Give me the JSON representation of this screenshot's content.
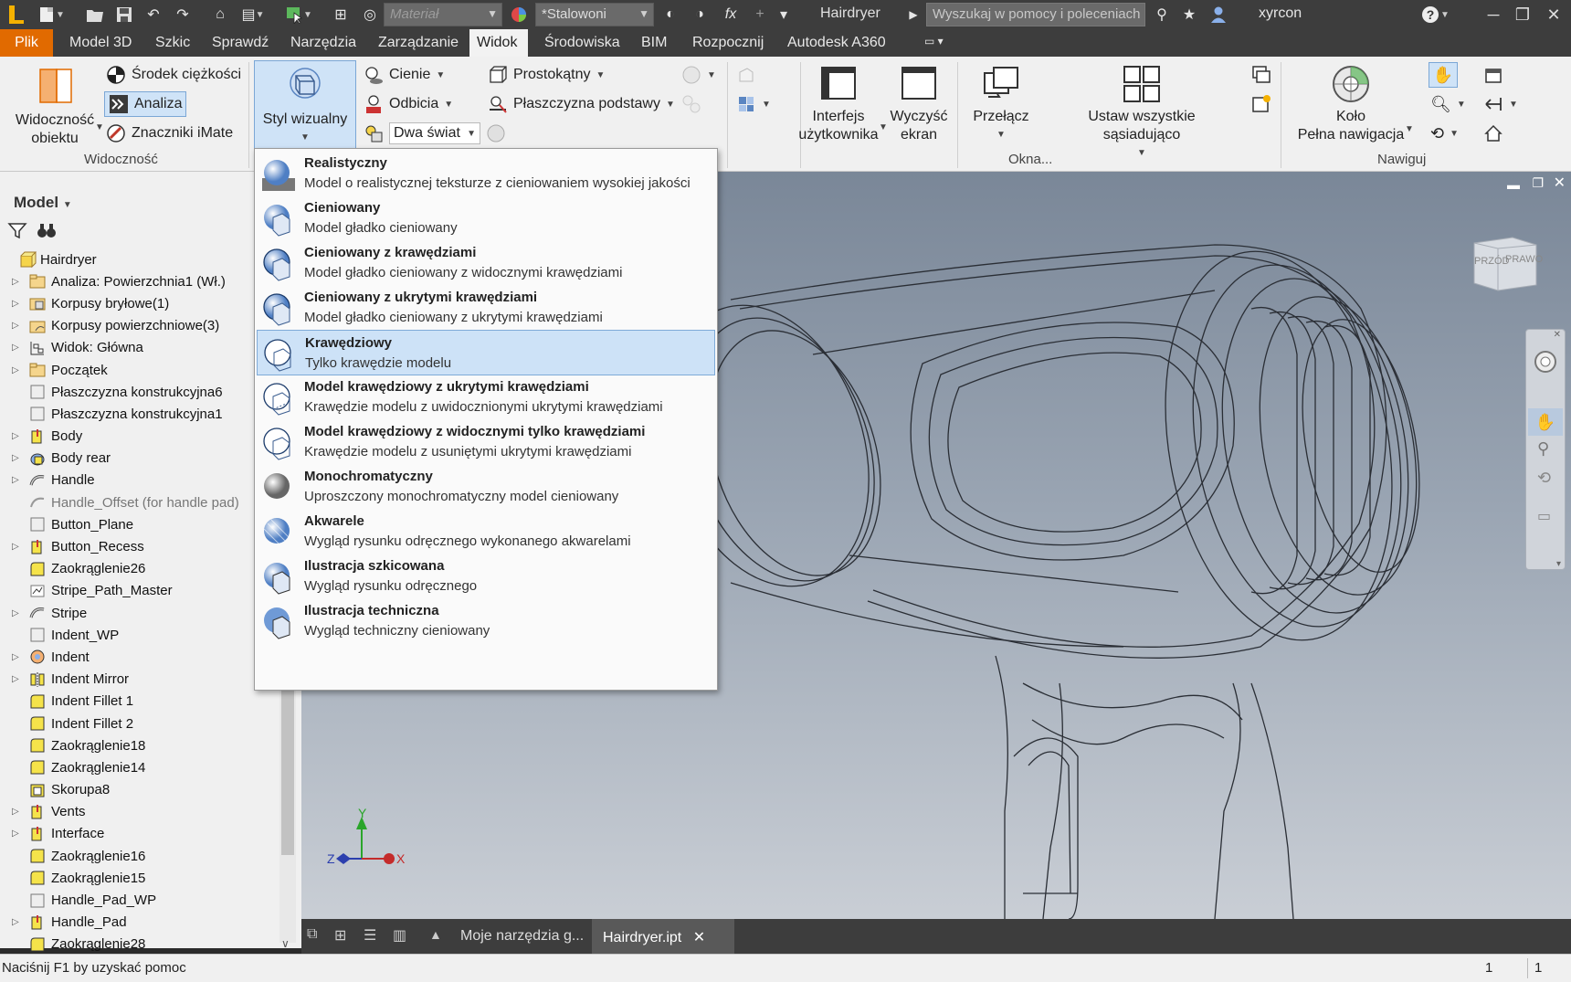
{
  "titlebar": {
    "material_placeholder": "Materiał",
    "appearance_value": "*Stalowoni",
    "title": "Hairdryer",
    "help_search_placeholder": "Wyszukaj w pomocy i poleceniach",
    "username": "xyrcon",
    "fx_label": "fx"
  },
  "menu_tabs": [
    "Plik",
    "Model 3D",
    "Szkic",
    "Sprawdź",
    "Narzędzia",
    "Zarządzanie",
    "Widok",
    "Środowiska",
    "BIM",
    "Rozpocznij",
    "Autodesk A360"
  ],
  "active_tab": "Widok",
  "ribbon": {
    "visibility_object_line1": "Widoczność",
    "visibility_object_line2": "obiektu",
    "center_of_gravity": "Środek ciężkości",
    "analysis": "Analiza",
    "imate_markers": "Znaczniki iMate",
    "group_visibility": "Widoczność",
    "visual_style_line1": "Styl wizualny",
    "shadows": "Cienie",
    "reflections": "Odbicia",
    "lighting": "Dwa świat",
    "projection": "Prostokątny",
    "ground_plane": "Płaszczyzna podstawy",
    "ui_line1": "Interfejs",
    "ui_line2": "użytkownika",
    "clear_line1": "Wyczyść",
    "clear_line2": "ekran",
    "switch": "Przełącz",
    "arrange_all": "Ustaw wszystkie sąsiadująco",
    "group_windows": "Okna...",
    "wheel_line1": "Koło",
    "wheel_line2": "Pełna nawigacja",
    "group_navigate": "Nawiguj"
  },
  "model_panel": {
    "title": "Model",
    "root": "Hairdryer",
    "items": [
      {
        "label": "Analiza: Powierzchnia1 (Wł.)",
        "expandable": true,
        "icon": "folder-icon"
      },
      {
        "label": "Korpusy bryłowe(1)",
        "expandable": true,
        "icon": "solid-bodies-icon"
      },
      {
        "label": "Korpusy powierzchniowe(3)",
        "expandable": true,
        "icon": "surface-bodies-icon"
      },
      {
        "label": "Widok: Główna",
        "expandable": true,
        "icon": "view-icon"
      },
      {
        "label": "Początek",
        "expandable": true,
        "icon": "folder-icon"
      },
      {
        "label": "Płaszczyzna konstrukcyjna6",
        "expandable": false,
        "icon": "workplane-icon"
      },
      {
        "label": "Płaszczyzna konstrukcyjna1",
        "expandable": false,
        "icon": "workplane-icon"
      },
      {
        "label": "Body",
        "expandable": true,
        "icon": "extrude-icon"
      },
      {
        "label": "Body rear",
        "expandable": true,
        "icon": "revolve-icon"
      },
      {
        "label": "Handle",
        "expandable": true,
        "icon": "sweep-icon"
      },
      {
        "label": "Handle_Offset (for handle pad)",
        "expandable": false,
        "icon": "offset-surface-icon",
        "dim": true
      },
      {
        "label": "Button_Plane",
        "expandable": false,
        "icon": "workplane-icon"
      },
      {
        "label": "Button_Recess",
        "expandable": true,
        "icon": "extrude-icon"
      },
      {
        "label": "Zaokrąglenie26",
        "expandable": false,
        "icon": "fillet-icon"
      },
      {
        "label": "Stripe_Path_Master",
        "expandable": false,
        "icon": "sketch-icon"
      },
      {
        "label": "Stripe",
        "expandable": true,
        "icon": "sweep-icon"
      },
      {
        "label": "Indent_WP",
        "expandable": false,
        "icon": "workplane-icon"
      },
      {
        "label": "Indent",
        "expandable": true,
        "icon": "emboss-icon"
      },
      {
        "label": "Indent Mirror",
        "expandable": true,
        "icon": "mirror-icon"
      },
      {
        "label": "Indent Fillet 1",
        "expandable": false,
        "icon": "fillet-icon"
      },
      {
        "label": "Indent Fillet 2",
        "expandable": false,
        "icon": "fillet-icon"
      },
      {
        "label": "Zaokrąglenie18",
        "expandable": false,
        "icon": "fillet-icon"
      },
      {
        "label": "Zaokrąglenie14",
        "expandable": false,
        "icon": "fillet-icon"
      },
      {
        "label": "Skorupa8",
        "expandable": false,
        "icon": "shell-icon"
      },
      {
        "label": "Vents",
        "expandable": true,
        "icon": "extrude-icon"
      },
      {
        "label": "Interface",
        "expandable": true,
        "icon": "extrude-icon"
      },
      {
        "label": "Zaokrąglenie16",
        "expandable": false,
        "icon": "fillet-icon"
      },
      {
        "label": "Zaokrąglenie15",
        "expandable": false,
        "icon": "fillet-icon"
      },
      {
        "label": "Handle_Pad_WP",
        "expandable": false,
        "icon": "workplane-icon"
      },
      {
        "label": "Handle_Pad",
        "expandable": true,
        "icon": "extrude-icon"
      },
      {
        "label": "Zaokrąglenie28",
        "expandable": false,
        "icon": "fillet-icon"
      }
    ]
  },
  "visual_styles": [
    {
      "title": "Realistyczny",
      "desc": "Model o realistycznej teksturze z cieniowaniem wysokiej jakości",
      "selected": false
    },
    {
      "title": "Cieniowany",
      "desc": "Model gładko cieniowany",
      "selected": false
    },
    {
      "title": "Cieniowany z krawędziami",
      "desc": "Model gładko cieniowany z widocznymi krawędziami",
      "selected": false
    },
    {
      "title": "Cieniowany z ukrytymi krawędziami",
      "desc": "Model gładko cieniowany z ukrytymi krawędziami",
      "selected": false
    },
    {
      "title": "Krawędziowy",
      "desc": "Tylko krawędzie modelu",
      "selected": true
    },
    {
      "title": "Model krawędziowy z ukrytymi krawędziami",
      "desc": "Krawędzie modelu z uwidocznionymi ukrytymi krawędziami",
      "selected": false
    },
    {
      "title": "Model krawędziowy z widocznymi tylko krawędziami",
      "desc": "Krawędzie modelu z usuniętymi ukrytymi krawędziami",
      "selected": false
    },
    {
      "title": "Monochromatyczny",
      "desc": "Uproszczony monochromatyczny model cieniowany",
      "selected": false
    },
    {
      "title": "Akwarele",
      "desc": "Wygląd rysunku odręcznego wykonanego akwarelami",
      "selected": false
    },
    {
      "title": "Ilustracja szkicowana",
      "desc": "Wygląd rysunku odręcznego",
      "selected": false
    },
    {
      "title": "Ilustracja techniczna",
      "desc": "Wygląd techniczny cieniowany",
      "selected": false
    }
  ],
  "viewcube": {
    "front": "PRZÓD",
    "right": "PRAWO"
  },
  "axes": {
    "x": "X",
    "y": "Y",
    "z": "Z"
  },
  "doc_tabs": [
    {
      "label": "Moje narzędzia g...",
      "active": false
    },
    {
      "label": "Hairdryer.ipt",
      "active": true
    }
  ],
  "status": {
    "text": "Naciśnij F1 by uzyskać pomoc",
    "num1": "1",
    "num2": "1"
  },
  "colors": {
    "file_tab": "#e16a00",
    "selection": "#cde2f7",
    "titlebar": "#3d3d3d"
  }
}
